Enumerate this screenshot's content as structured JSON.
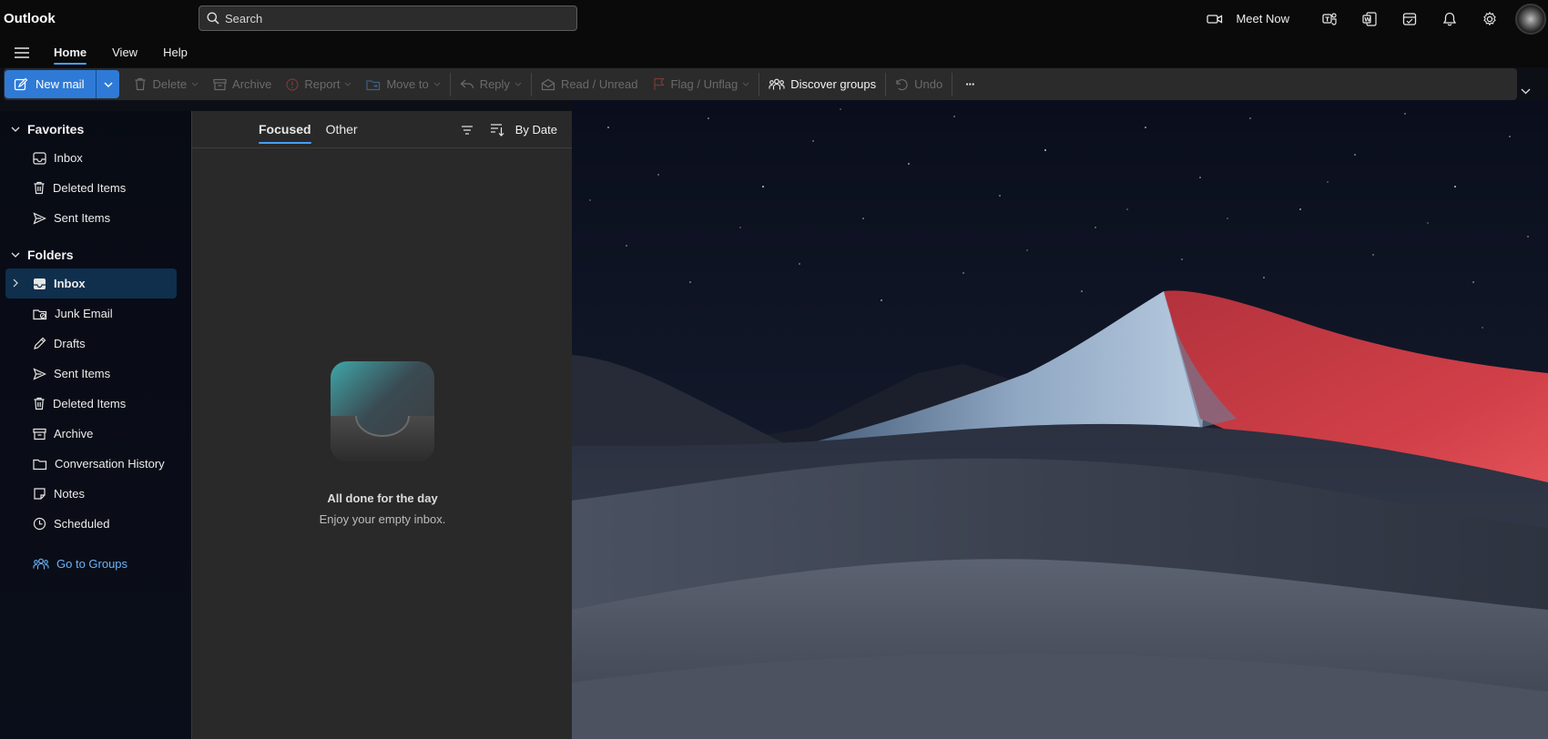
{
  "app": {
    "title": "Outlook"
  },
  "search": {
    "placeholder": "Search"
  },
  "header_actions": {
    "meet_now_label": "Meet Now",
    "icons": [
      "video-icon",
      "teams-icon",
      "word-icon",
      "my-day-icon",
      "bell-icon",
      "gear-icon"
    ]
  },
  "nav": {
    "tabs": [
      {
        "label": "Home",
        "active": true
      },
      {
        "label": "View",
        "active": false
      },
      {
        "label": "Help",
        "active": false
      }
    ]
  },
  "ribbon": {
    "new_mail": "New mail",
    "delete": "Delete",
    "archive": "Archive",
    "report": "Report",
    "move_to": "Move to",
    "reply": "Reply",
    "read_unread": "Read / Unread",
    "flag_unflag": "Flag / Unflag",
    "discover_groups": "Discover groups",
    "undo": "Undo",
    "more": "···"
  },
  "favorites": {
    "title": "Favorites",
    "items": [
      {
        "label": "Inbox",
        "icon": "inbox-icon"
      },
      {
        "label": "Deleted Items",
        "icon": "trash-icon"
      },
      {
        "label": "Sent Items",
        "icon": "send-icon"
      }
    ]
  },
  "folders": {
    "title": "Folders",
    "items": [
      {
        "label": "Inbox",
        "icon": "inbox-icon",
        "selected": true
      },
      {
        "label": "Junk Email",
        "icon": "junk-icon"
      },
      {
        "label": "Drafts",
        "icon": "pencil-icon"
      },
      {
        "label": "Sent Items",
        "icon": "send-icon"
      },
      {
        "label": "Deleted Items",
        "icon": "trash-icon"
      },
      {
        "label": "Archive",
        "icon": "archive-icon"
      },
      {
        "label": "Conversation History",
        "icon": "folder-icon"
      },
      {
        "label": "Notes",
        "icon": "note-icon"
      },
      {
        "label": "Scheduled",
        "icon": "clock-icon"
      }
    ],
    "go_to_groups": "Go to Groups"
  },
  "message_list": {
    "tabs": {
      "focused": "Focused",
      "other": "Other"
    },
    "sort_label": "By Date",
    "empty_title": "All done for the day",
    "empty_subtitle": "Enjoy your empty inbox."
  },
  "colors": {
    "accent": "#479ef5",
    "primary_button": "#2f7ad6",
    "link": "#6cb3f5",
    "selected_folder": "#0f2f4d"
  }
}
